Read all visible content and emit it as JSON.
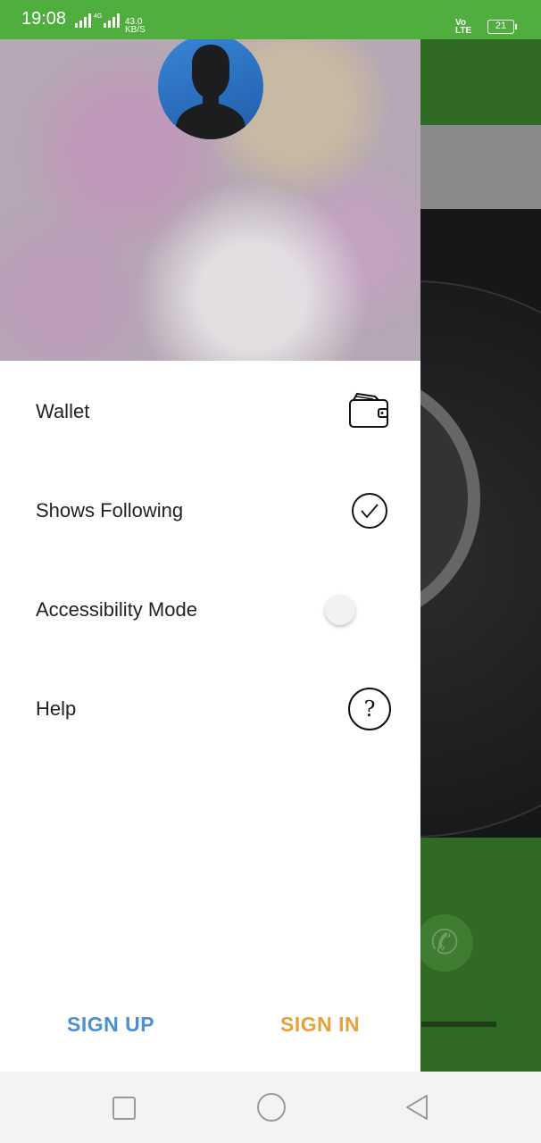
{
  "status_bar": {
    "time": "19:08",
    "net_rate_value": "43.0",
    "net_rate_unit": "KB/S",
    "network_type": "4G",
    "volte_top": "Vo",
    "volte_bottom": "LTE",
    "battery": "21"
  },
  "drawer": {
    "menu_items": [
      {
        "label": "Wallet",
        "icon": "wallet-icon"
      },
      {
        "label": "Shows Following",
        "icon": "check-circle-icon"
      },
      {
        "label": "Accessibility Mode",
        "icon": "toggle-switch",
        "toggle_on": false
      },
      {
        "label": "Help",
        "icon": "help-circle-icon"
      }
    ],
    "sign_up_label": "SIGN UP",
    "sign_in_label": "SIGN IN"
  },
  "colors": {
    "status_bar": "#4fae3d",
    "background_green": "#2f6b25",
    "sign_up": "#4a90d2",
    "sign_in": "#e8a03a"
  }
}
